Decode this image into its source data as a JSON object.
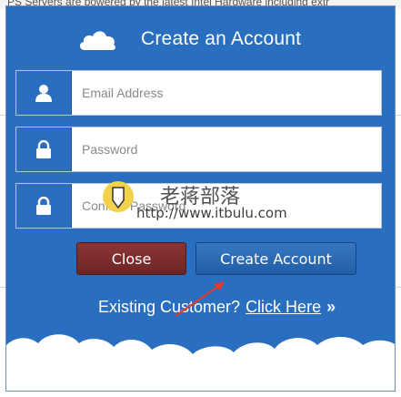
{
  "background": {
    "top_text": "PS Servers are powered by the latest Intel Hardware including extr"
  },
  "dialog": {
    "title": "Create an Account",
    "fields": [
      {
        "name": "email",
        "placeholder": "Email Address",
        "icon": "user-icon"
      },
      {
        "name": "password",
        "placeholder": "Password",
        "icon": "lock-icon"
      },
      {
        "name": "confirm",
        "placeholder": "Confirm Password",
        "icon": "lock-icon"
      }
    ],
    "buttons": {
      "close": "Close",
      "create": "Create Account"
    },
    "existing": {
      "prompt": "Existing Customer?",
      "link": "Click Here",
      "chevron": "»"
    }
  },
  "watermark": {
    "text": "老蒋部落",
    "url": "http://www.itbulu.com"
  },
  "colors": {
    "dialog_bg": "#2a6ec0",
    "close_btn": "#7a2b2b",
    "create_btn": "#2b66ad"
  }
}
